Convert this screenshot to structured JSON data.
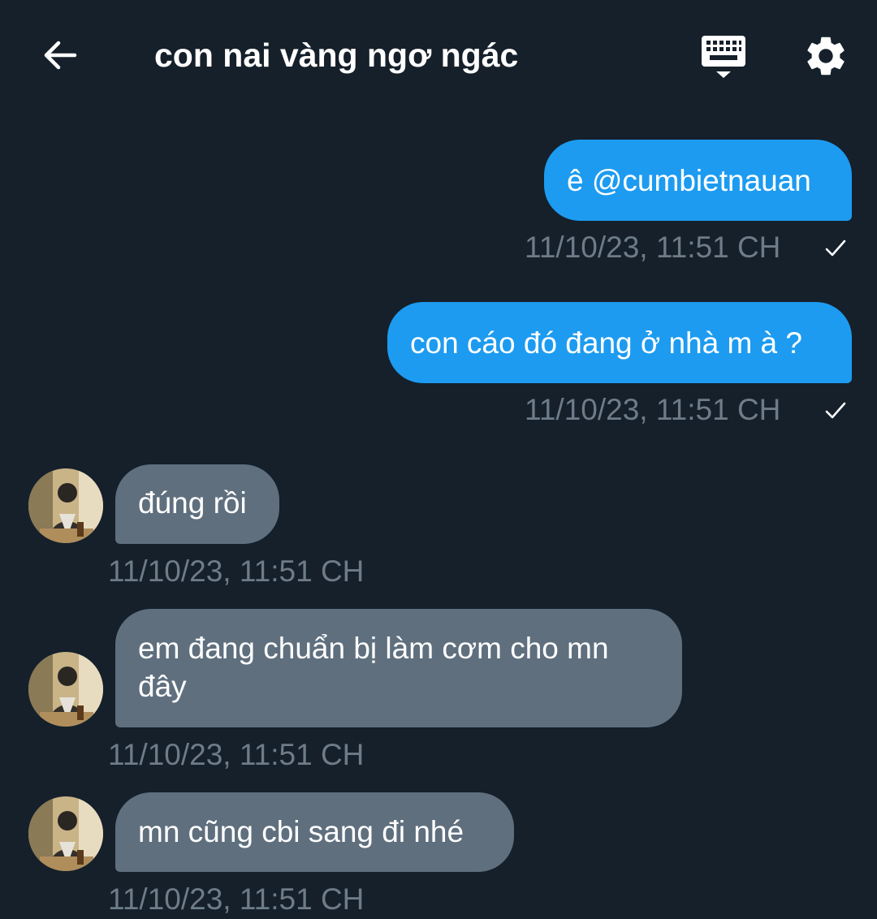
{
  "header": {
    "title": "con nai vàng ngơ ngác",
    "back_icon": "arrow-left-icon",
    "keyboard_icon": "keyboard-icon",
    "settings_icon": "gear-icon"
  },
  "messages": [
    {
      "direction": "outgoing",
      "text": "ê @cumbietnauan",
      "timestamp": "11/10/23, 11:51 CH",
      "status_icon": "check-icon"
    },
    {
      "direction": "outgoing",
      "text": "con cáo đó đang ở nhà m à ?",
      "timestamp": "11/10/23, 11:51 CH",
      "status_icon": "check-icon"
    },
    {
      "direction": "incoming",
      "text": "đúng rồi",
      "timestamp": "11/10/23, 11:51 CH"
    },
    {
      "direction": "incoming",
      "text": "em đang chuẩn bị làm cơm cho mn",
      "text_line2": "đây",
      "timestamp": "11/10/23, 11:51 CH"
    },
    {
      "direction": "incoming",
      "text": "mn cũng cbi sang đi nhé",
      "timestamp": "11/10/23, 11:51 CH"
    }
  ],
  "colors": {
    "background": "#15202b",
    "outgoing_bubble": "#1d9bf0",
    "incoming_bubble": "#5f6f7e",
    "timestamp": "#6e7c89"
  }
}
